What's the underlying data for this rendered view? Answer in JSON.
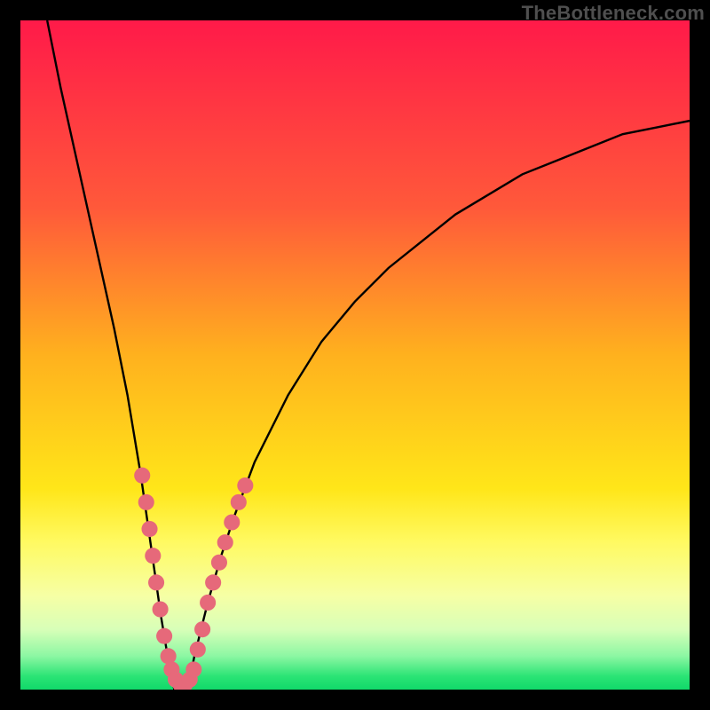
{
  "watermark": "TheBottleneck.com",
  "chart_data": {
    "type": "line",
    "title": "",
    "xlabel": "",
    "ylabel": "",
    "xlim": [
      0,
      100
    ],
    "ylim": [
      0,
      100
    ],
    "grid": false,
    "gradient_stops": [
      {
        "offset": 0,
        "color": "#ff1a49"
      },
      {
        "offset": 28,
        "color": "#ff593a"
      },
      {
        "offset": 50,
        "color": "#ffb11e"
      },
      {
        "offset": 70,
        "color": "#ffe619"
      },
      {
        "offset": 78,
        "color": "#fffa62"
      },
      {
        "offset": 86,
        "color": "#f6ffa5"
      },
      {
        "offset": 91,
        "color": "#d8ffb8"
      },
      {
        "offset": 95,
        "color": "#8cf7a3"
      },
      {
        "offset": 98,
        "color": "#2be475"
      },
      {
        "offset": 100,
        "color": "#11d96a"
      }
    ],
    "series": [
      {
        "name": "left-curve",
        "x": [
          4,
          6,
          8,
          10,
          12,
          14,
          16,
          17,
          18,
          19,
          20,
          21,
          22,
          23
        ],
        "y": [
          100,
          90,
          81,
          72,
          63,
          54,
          44,
          38,
          32,
          25,
          18,
          11,
          5,
          0
        ]
      },
      {
        "name": "right-curve",
        "x": [
          25,
          26,
          27,
          28,
          30,
          32,
          35,
          40,
          45,
          50,
          55,
          60,
          65,
          70,
          75,
          80,
          85,
          90,
          95,
          100
        ],
        "y": [
          0,
          5,
          9,
          13,
          20,
          26,
          34,
          44,
          52,
          58,
          63,
          67,
          71,
          74,
          77,
          79,
          81,
          83,
          84,
          85
        ]
      }
    ],
    "markers": {
      "name": "data-points",
      "color": "#e6697a",
      "radius": 1.2,
      "points": [
        {
          "x": 18.2,
          "y": 32
        },
        {
          "x": 18.8,
          "y": 28
        },
        {
          "x": 19.3,
          "y": 24
        },
        {
          "x": 19.8,
          "y": 20
        },
        {
          "x": 20.3,
          "y": 16
        },
        {
          "x": 20.9,
          "y": 12
        },
        {
          "x": 21.5,
          "y": 8
        },
        {
          "x": 22.1,
          "y": 5
        },
        {
          "x": 22.6,
          "y": 3
        },
        {
          "x": 23.2,
          "y": 1.5
        },
        {
          "x": 23.9,
          "y": 0.8
        },
        {
          "x": 24.6,
          "y": 0.8
        },
        {
          "x": 25.3,
          "y": 1.5
        },
        {
          "x": 25.9,
          "y": 3
        },
        {
          "x": 26.5,
          "y": 6
        },
        {
          "x": 27.2,
          "y": 9
        },
        {
          "x": 28.0,
          "y": 13
        },
        {
          "x": 28.8,
          "y": 16
        },
        {
          "x": 29.7,
          "y": 19
        },
        {
          "x": 30.6,
          "y": 22
        },
        {
          "x": 31.6,
          "y": 25
        },
        {
          "x": 32.6,
          "y": 28
        },
        {
          "x": 33.6,
          "y": 30.5
        }
      ]
    }
  }
}
